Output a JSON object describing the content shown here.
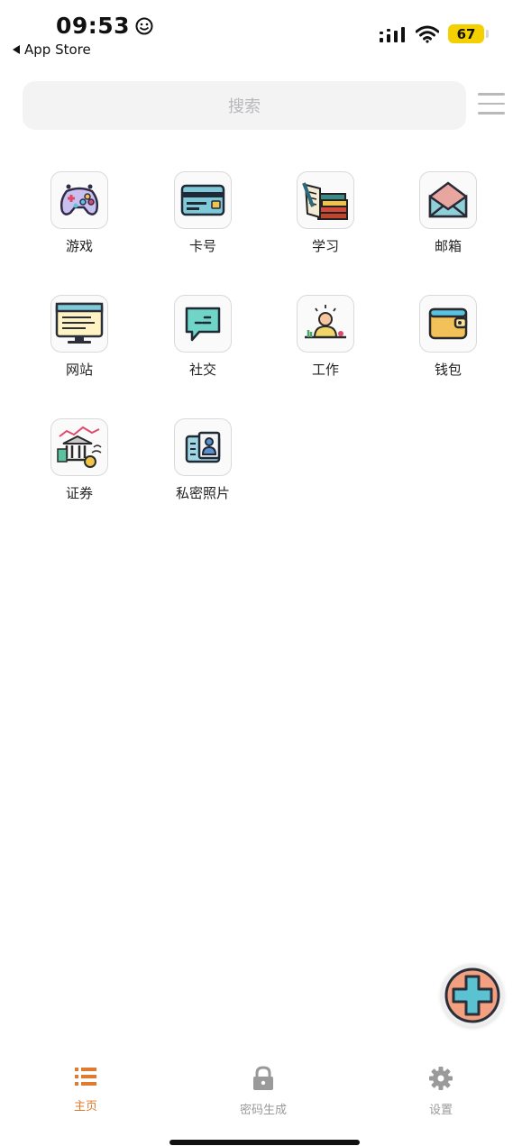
{
  "status_bar": {
    "time": "09:53",
    "back_label": "App Store",
    "battery": "67"
  },
  "search": {
    "placeholder": "搜索"
  },
  "categories": [
    {
      "label": "游戏",
      "icon": "gamepad-icon"
    },
    {
      "label": "卡号",
      "icon": "credit-card-icon"
    },
    {
      "label": "学习",
      "icon": "books-icon"
    },
    {
      "label": "邮箱",
      "icon": "envelope-icon"
    },
    {
      "label": "网站",
      "icon": "monitor-icon"
    },
    {
      "label": "社交",
      "icon": "chat-bubble-icon"
    },
    {
      "label": "工作",
      "icon": "worker-icon"
    },
    {
      "label": "钱包",
      "icon": "wallet-icon"
    },
    {
      "label": "证券",
      "icon": "bank-stocks-icon"
    },
    {
      "label": "私密照片",
      "icon": "id-photo-icon"
    }
  ],
  "tabs": [
    {
      "label": "主页",
      "icon": "list-icon",
      "active": true
    },
    {
      "label": "密码生成",
      "icon": "lock-icon",
      "active": false
    },
    {
      "label": "设置",
      "icon": "gear-icon",
      "active": false
    }
  ],
  "colors": {
    "active_tab": "#e07a2e",
    "inactive_tab": "#9a9a9a",
    "battery": "#f5d000"
  }
}
